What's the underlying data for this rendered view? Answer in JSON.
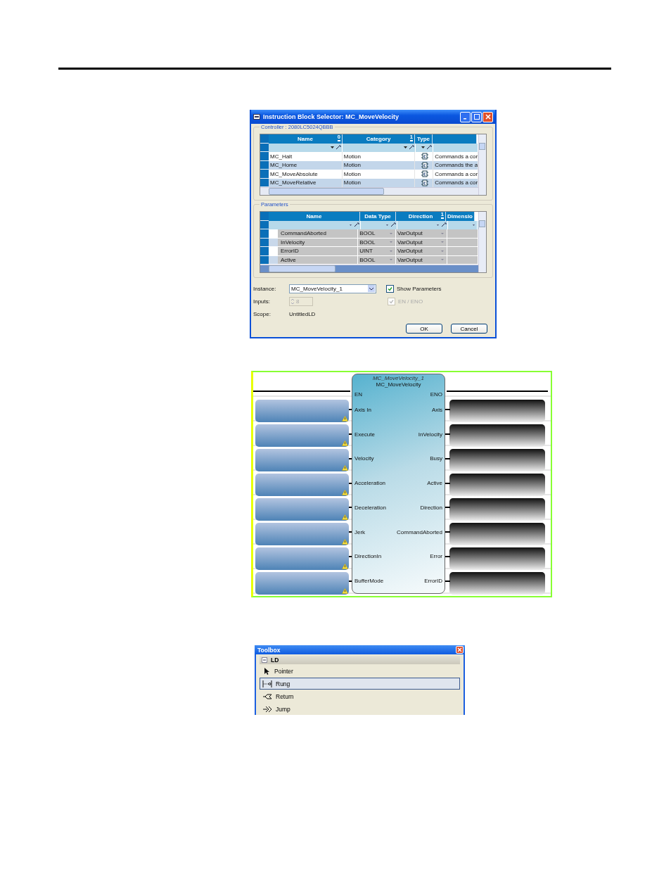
{
  "dialog": {
    "title": "Instruction Block Selector: MC_MoveVelocity",
    "controller": {
      "label": "Controller : 2080LC5024QBBB",
      "columns": [
        {
          "label": "Name",
          "sort_order": "0"
        },
        {
          "label": "Category",
          "sort_order": "1"
        },
        {
          "label": "Type"
        }
      ],
      "rows": [
        {
          "name": "MC_Halt",
          "category": "Motion",
          "description": "Commands a cor"
        },
        {
          "name": "MC_Home",
          "category": "Motion",
          "description": "Commands the a"
        },
        {
          "name": "MC_MoveAbsolute",
          "category": "Motion",
          "description": "Commands a cor"
        },
        {
          "name": "MC_MoveRelative",
          "category": "Motion",
          "description": "Commands a cor"
        }
      ]
    },
    "parameters": {
      "label": "Parameters",
      "columns": [
        {
          "label": "Name"
        },
        {
          "label": "Data Type"
        },
        {
          "label": "Direction",
          "sort_order": "1"
        },
        {
          "label": "Dimensio"
        }
      ],
      "rows": [
        {
          "name": "CommandAborted",
          "data_type": "BOOL",
          "direction": "VarOutput"
        },
        {
          "name": "InVelocity",
          "data_type": "BOOL",
          "direction": "VarOutput"
        },
        {
          "name": "ErrorID",
          "data_type": "UINT",
          "direction": "VarOutput"
        },
        {
          "name": "Active",
          "data_type": "BOOL",
          "direction": "VarOutput"
        }
      ]
    },
    "instance": {
      "label": "Instance:",
      "value": "MC_MoveVelocity_1"
    },
    "show_parameters": {
      "label": "Show Parameters",
      "checked": true,
      "disabled": false
    },
    "inputs": {
      "label": "Inputs:",
      "value": "8",
      "disabled": true
    },
    "en_eno": {
      "label": "EN / ENO",
      "checked": true,
      "disabled": true
    },
    "scope": {
      "label": "Scope:",
      "value": "UntitledLD"
    },
    "buttons": [
      "OK",
      "Cancel"
    ]
  },
  "block": {
    "instance": "MC_MoveVelocity_1",
    "type": "MC_MoveVelocity",
    "en": "EN",
    "eno": "ENO",
    "inputs": [
      {
        "label": "Axis In",
        "warning": true
      },
      {
        "label": "Execute",
        "warning": true
      },
      {
        "label": "Velocity",
        "warning": true
      },
      {
        "label": "Acceleration",
        "warning": true
      },
      {
        "label": "Deceleration",
        "warning": true
      },
      {
        "label": "Jerk",
        "warning": true
      },
      {
        "label": "DirectionIn",
        "warning": true
      },
      {
        "label": "BufferMode",
        "warning": true
      }
    ],
    "outputs": [
      "Axis",
      "InVelocity",
      "Busy",
      "Active",
      "Direction",
      "CommandAborted",
      "Error",
      "ErrorID"
    ]
  },
  "toolbox": {
    "title": "Toolbox",
    "group": {
      "label": "LD",
      "expanded": true
    },
    "items": [
      {
        "label": "Pointer",
        "kind": "pointer",
        "selected": false
      },
      {
        "label": "Rung",
        "kind": "rung",
        "selected": true
      },
      {
        "label": "Return",
        "kind": "return",
        "selected": false
      },
      {
        "label": "Jump",
        "kind": "jump",
        "selected": false
      }
    ]
  }
}
